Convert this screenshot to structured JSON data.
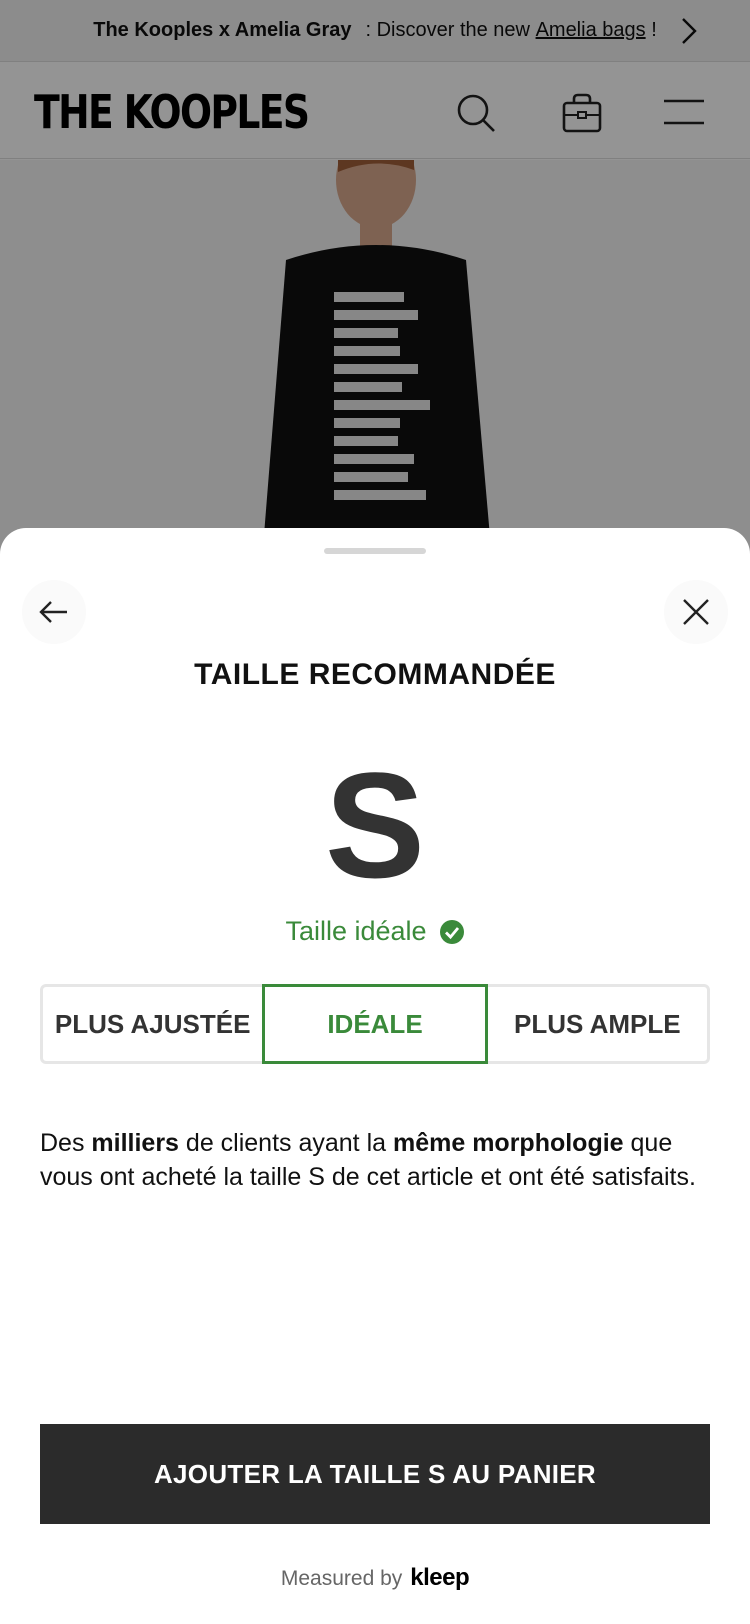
{
  "promo": {
    "brand": "The Kooples x Amelia Gray",
    "text": ": Discover the new",
    "link": "Amelia bags",
    "suffix": "!"
  },
  "header": {
    "logo": "THE KOOPLES"
  },
  "sheet": {
    "title": "TAILLE RECOMMANDÉE",
    "size": "S",
    "status": "Taille idéale",
    "fit_options": [
      "PLUS AJUSTÉE",
      "IDÉALE",
      "PLUS AMPLE"
    ],
    "selected_fit": "IDÉALE",
    "desc": {
      "p1": "Des ",
      "b1": "milliers",
      "p2": " de clients ayant la ",
      "b2": "même morphologie",
      "p3": " que vous ont acheté la taille S de cet article et ont été satisfaits."
    },
    "cta": "AJOUTER LA TAILLE S AU PANIER",
    "footer_text": "Measured by",
    "footer_brand": "kleep"
  },
  "colors": {
    "accent_green": "#3a8a3a",
    "cta_bg": "#2b2b2b"
  }
}
